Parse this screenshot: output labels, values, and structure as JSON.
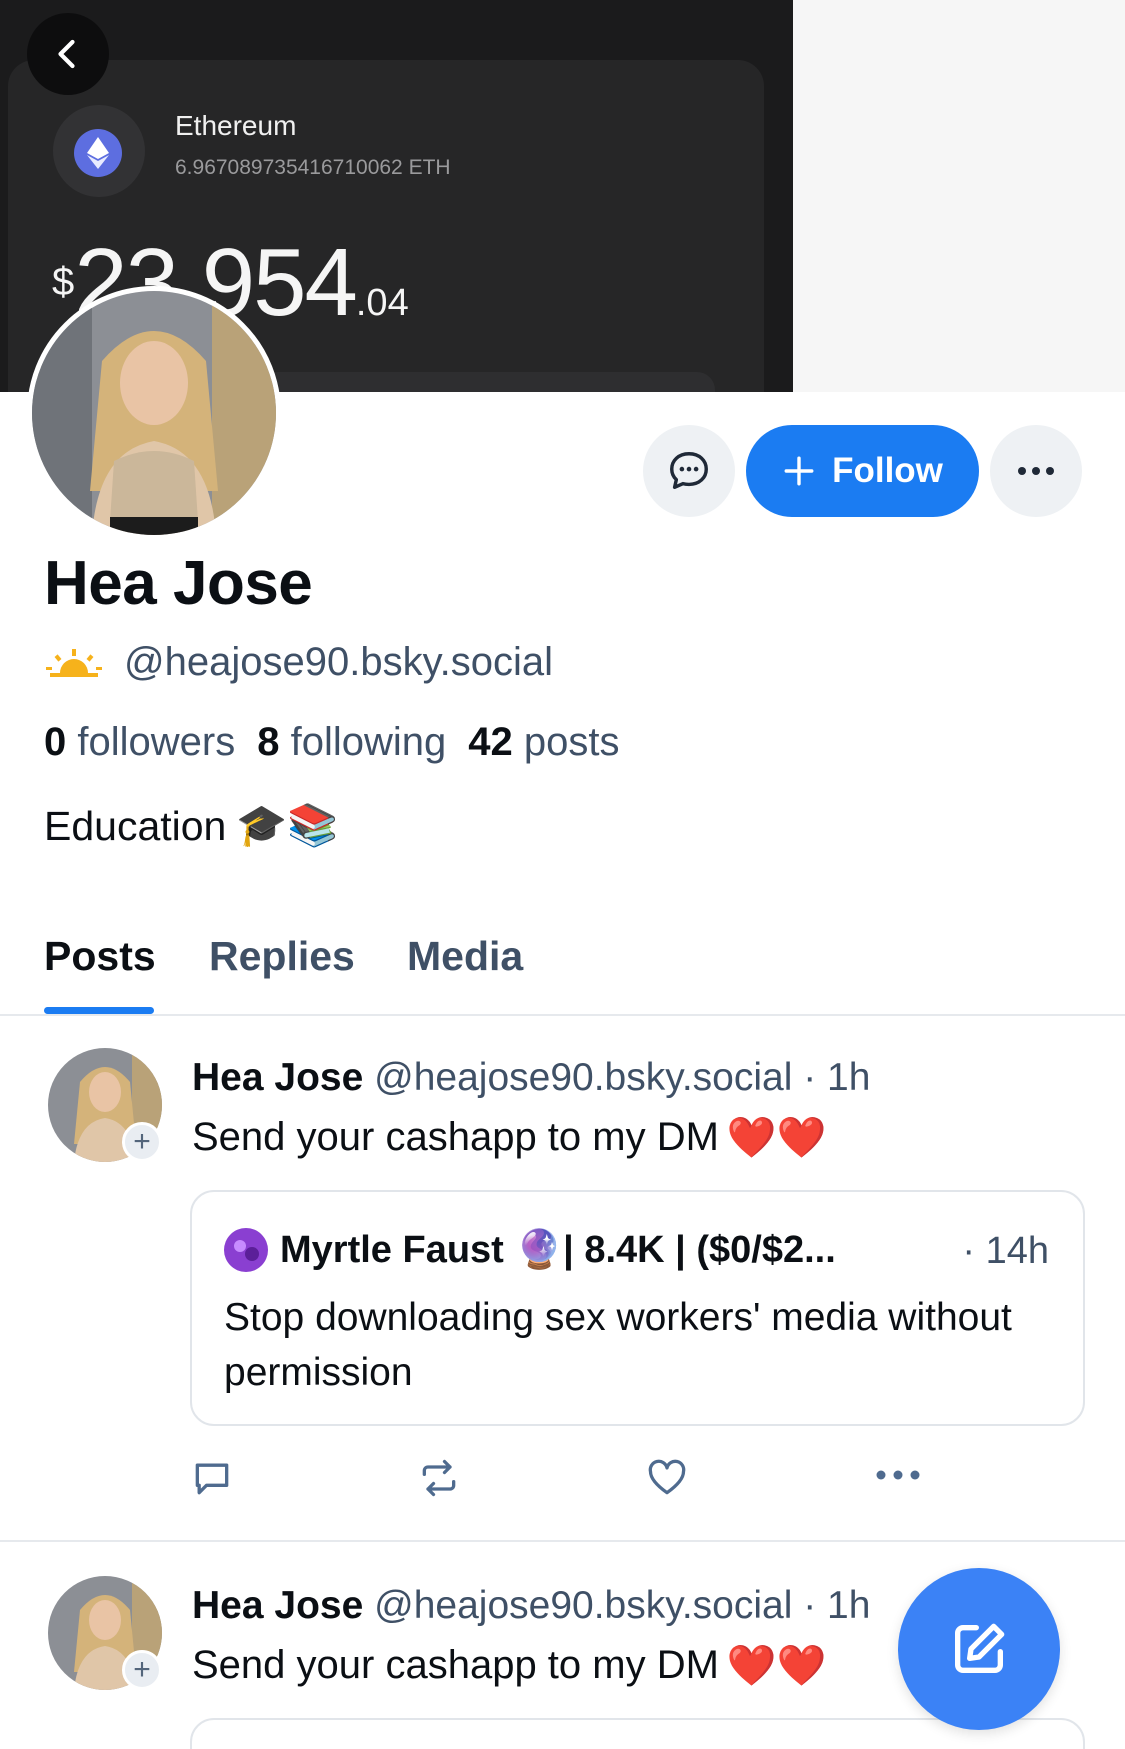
{
  "banner": {
    "asset_name": "Ethereum",
    "asset_amount": "6.967089735416710062 ETH",
    "balance_currency": "$",
    "balance_main": "23,954",
    "balance_cents": ".04"
  },
  "profile": {
    "display_name": "Hea Jose",
    "handle": "@heajose90.bsky.social",
    "followers_count": "0",
    "followers_label": "followers",
    "following_count": "8",
    "following_label": "following",
    "posts_count": "42",
    "posts_label": "posts",
    "bio": "Education",
    "bio_emojis": "🎓📚"
  },
  "actions": {
    "follow_label": "Follow"
  },
  "tabs": [
    {
      "label": "Posts",
      "active": true
    },
    {
      "label": "Replies",
      "active": false
    },
    {
      "label": "Media",
      "active": false
    }
  ],
  "posts": [
    {
      "author": "Hea Jose",
      "handle": "@heajose90.bsky.social",
      "time": "· 1h",
      "text": "Send your cashapp to my DM",
      "emoji": "❤️❤️",
      "quote": {
        "author": "Myrtle Faust",
        "author_suffix": "🔮| 8.4K | ($0/$2...",
        "time": "· 14h",
        "text": "Stop downloading sex workers' media without permission"
      }
    },
    {
      "author": "Hea Jose",
      "handle": "@heajose90.bsky.social",
      "time": "· 1h",
      "text": "Send your cashapp to my DM",
      "emoji": "❤️❤️"
    }
  ],
  "icons": {
    "back": "chevron-left-icon",
    "message": "chat-bubble-icon",
    "follow": "plus-icon",
    "more": "ellipsis-icon",
    "reply": "comment-icon",
    "repost": "repost-icon",
    "like": "heart-icon",
    "compose": "compose-icon",
    "eth": "ethereum-icon",
    "sun": "sunrise-icon"
  },
  "colors": {
    "accent": "#1b7cf2",
    "fab": "#3b82f6",
    "muted_text": "#3f5066"
  }
}
